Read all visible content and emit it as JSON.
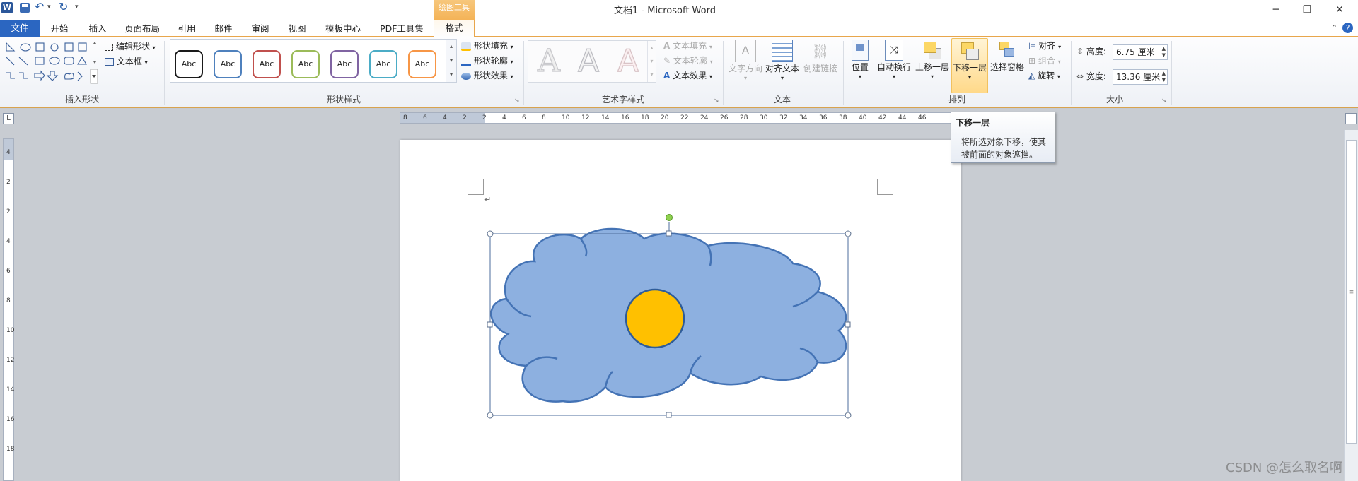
{
  "window": {
    "title": "文档1 - Microsoft Word",
    "context_group": "绘图工具",
    "controls": {
      "minimize": "─",
      "restore": "❐",
      "close": "✕"
    }
  },
  "quick_access": {
    "undo_arrow": "▾",
    "more": "▾"
  },
  "tabs": [
    {
      "label": "文件"
    },
    {
      "label": "开始"
    },
    {
      "label": "插入"
    },
    {
      "label": "页面布局"
    },
    {
      "label": "引用"
    },
    {
      "label": "邮件"
    },
    {
      "label": "审阅"
    },
    {
      "label": "视图"
    },
    {
      "label": "模板中心"
    },
    {
      "label": "PDF工具集"
    },
    {
      "label": "格式"
    }
  ],
  "ribbon": {
    "insert_shapes": {
      "edit_shape": "编辑形状",
      "textbox": "文本框",
      "label": "插入形状"
    },
    "shape_styles": {
      "style_label": "Abc",
      "fill": "形状填充",
      "outline": "形状轮廓",
      "effects": "形状效果",
      "label": "形状样式",
      "border_colors": [
        "#1a1a1a",
        "#4f81bd",
        "#c0504d",
        "#9bbb59",
        "#8064a2",
        "#4bacc6",
        "#f79646"
      ]
    },
    "wordart": {
      "fill": "文本填充",
      "outline": "文本轮廓",
      "effects": "文本效果",
      "label": "艺术字样式",
      "letter": "A"
    },
    "text": {
      "direction": "文字方向",
      "align": "对齐文本",
      "link": "创建链接",
      "label": "文本"
    },
    "arrange": {
      "position": "位置",
      "wrap": "自动换行",
      "bring_forward": "上移一层",
      "send_backward": "下移一层",
      "selection_pane": "选择窗格",
      "align": "对齐",
      "group": "组合",
      "rotate": "旋转",
      "label": "排列"
    },
    "size": {
      "height_label": "高度:",
      "height_value": "6.75 厘米",
      "width_label": "宽度:",
      "width_value": "13.36 厘米",
      "label": "大小"
    }
  },
  "tooltip": {
    "title": "下移一层",
    "body_line1": "将所选对象下移，使其",
    "body_line2": "被前面的对象遮挡。"
  },
  "ruler": {
    "h_labels": [
      "8",
      "6",
      "4",
      "2",
      "2",
      "4",
      "6",
      "8",
      "10",
      "12",
      "14",
      "16",
      "18",
      "20",
      "22",
      "24",
      "26",
      "28",
      "30",
      "32",
      "34",
      "36",
      "38",
      "40",
      "42",
      "44",
      "46"
    ],
    "v_labels": [
      "4",
      "2",
      "2",
      "4",
      "6",
      "8",
      "10",
      "12",
      "14",
      "16",
      "18"
    ]
  },
  "document": {
    "paragraph_mark": "↵"
  },
  "shapes": {
    "cloud_fill": "#8db0e0",
    "cloud_stroke": "#4473b5",
    "circle_fill": "#ffc000",
    "circle_stroke": "#2e5c99"
  },
  "watermark": "CSDN @怎么取名啊"
}
